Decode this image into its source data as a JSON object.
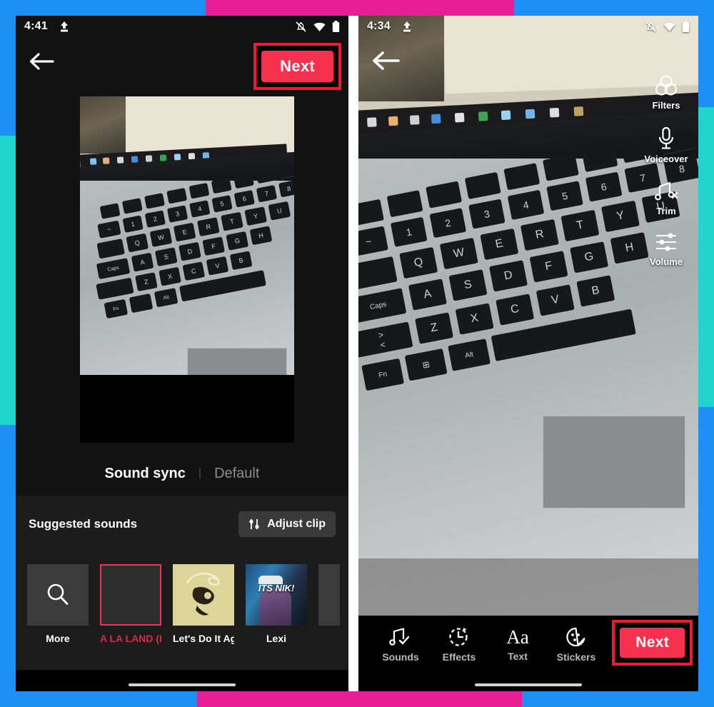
{
  "frame": {
    "colors": {
      "blue": "#1e90f5",
      "pink": "#e81e96",
      "teal": "#1fd5cd",
      "accent_red": "#ed1b2e",
      "tiktok_pink": "#f5314f",
      "panel_dark": "#1c1c1c",
      "app_dark": "#121212"
    }
  },
  "left_phone": {
    "status": {
      "clock": "4:41",
      "icons": [
        "upload-icon",
        "notifications-off-icon",
        "wifi-icon",
        "battery-icon"
      ]
    },
    "topbar": {
      "back_label": "Back",
      "next_label": "Next"
    },
    "tabs": [
      {
        "label": "Sound sync",
        "active": true
      },
      {
        "label": "Default",
        "active": false
      }
    ],
    "panel": {
      "title": "Suggested sounds",
      "adjust_clip_label": "Adjust clip"
    },
    "sounds": [
      {
        "label": "More",
        "kind": "search",
        "selected": false
      },
      {
        "label": "A LA LAND (I",
        "kind": "empty",
        "selected": true
      },
      {
        "label": "Let's Do It Ag",
        "kind": "art-lets",
        "selected": false
      },
      {
        "label": "Lexi",
        "kind": "art-lexi",
        "art_text": "ITS NIK!",
        "selected": false
      },
      {
        "label": "",
        "kind": "partial",
        "selected": false
      }
    ]
  },
  "right_phone": {
    "status": {
      "clock": "4:34",
      "icons": [
        "upload-icon",
        "notifications-off-icon",
        "wifi-icon",
        "battery-icon"
      ]
    },
    "topbar": {
      "back_label": "Back"
    },
    "side_tools": [
      {
        "label": "Filters",
        "icon": "filters-icon"
      },
      {
        "label": "Voiceover",
        "icon": "microphone-icon"
      },
      {
        "label": "Trim",
        "icon": "trim-scissors-icon"
      },
      {
        "label": "Volume",
        "icon": "sliders-icon"
      }
    ],
    "bottom_tools": [
      {
        "label": "Sounds",
        "icon": "music-check-icon"
      },
      {
        "label": "Effects",
        "icon": "effects-clock-icon"
      },
      {
        "label": "Text",
        "icon": "text-aa-icon"
      },
      {
        "label": "Stickers",
        "icon": "sticker-face-icon"
      }
    ],
    "next_label": "Next"
  }
}
